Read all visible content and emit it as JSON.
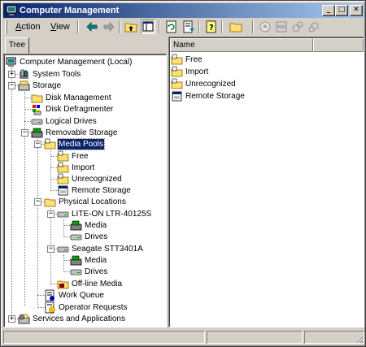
{
  "window": {
    "title": "Computer Management",
    "controls": {
      "minimize": "_",
      "maximize": "□",
      "close": "✕"
    }
  },
  "menubar": {
    "items": [
      {
        "mnemonic": "A",
        "rest": "ction"
      },
      {
        "mnemonic": "V",
        "rest": "iew"
      }
    ],
    "toolbar_icons": [
      "back-icon",
      "forward-icon",
      "up-folder-icon",
      "show-hide-tree-icon",
      "refresh-icon",
      "export-list-icon",
      "help-icon",
      "new-folder-icon",
      "eject-icon",
      "mount-icon",
      "cleanup-icon",
      "configure-icon"
    ]
  },
  "tree": {
    "tab_label": "Tree",
    "nodes": [
      {
        "label": "Computer Management (Local)",
        "icon": "computer-icon"
      },
      {
        "label": "System Tools",
        "icon": "tools-icon"
      },
      {
        "label": "Storage",
        "icon": "storage-icon"
      },
      {
        "label": "Disk Management",
        "icon": "folder-icon"
      },
      {
        "label": "Disk Defragmenter",
        "icon": "defrag-icon"
      },
      {
        "label": "Logical Drives",
        "icon": "drive-icon"
      },
      {
        "label": "Removable Storage",
        "icon": "removable-storage-icon"
      },
      {
        "label": "Media Pools",
        "icon": "media-pool-icon",
        "selected": true
      },
      {
        "label": "Free",
        "icon": "media-pool-icon"
      },
      {
        "label": "Import",
        "icon": "media-pool-icon"
      },
      {
        "label": "Unrecognized",
        "icon": "media-pool-icon"
      },
      {
        "label": "Remote Storage",
        "icon": "remote-storage-icon"
      },
      {
        "label": "Physical Locations",
        "icon": "folder-icon"
      },
      {
        "label": "LITE-ON LTR-40125S",
        "icon": "drive-icon"
      },
      {
        "label": "Media",
        "icon": "media-icon"
      },
      {
        "label": "Drives",
        "icon": "drive-icon"
      },
      {
        "label": "Seagate STT3401A",
        "icon": "drive-icon"
      },
      {
        "label": "Media",
        "icon": "media-icon"
      },
      {
        "label": "Drives",
        "icon": "drive-icon"
      },
      {
        "label": "Off-line Media",
        "icon": "offline-media-icon"
      },
      {
        "label": "Work Queue",
        "icon": "work-queue-icon"
      },
      {
        "label": "Operator Requests",
        "icon": "operator-requests-icon"
      },
      {
        "label": "Services and Applications",
        "icon": "services-icon"
      }
    ]
  },
  "list": {
    "columns": [
      "Name",
      ""
    ],
    "items": [
      {
        "label": "Free",
        "icon": "media-pool-icon"
      },
      {
        "label": "Import",
        "icon": "media-pool-icon"
      },
      {
        "label": "Unrecognized",
        "icon": "media-pool-icon"
      },
      {
        "label": "Remote Storage",
        "icon": "remote-storage-icon"
      }
    ]
  },
  "colors": {
    "title_bar_start": "#0a246a",
    "title_bar_end": "#a6caf0",
    "selection": "#0a246a",
    "window_face": "#d4d0c8"
  }
}
